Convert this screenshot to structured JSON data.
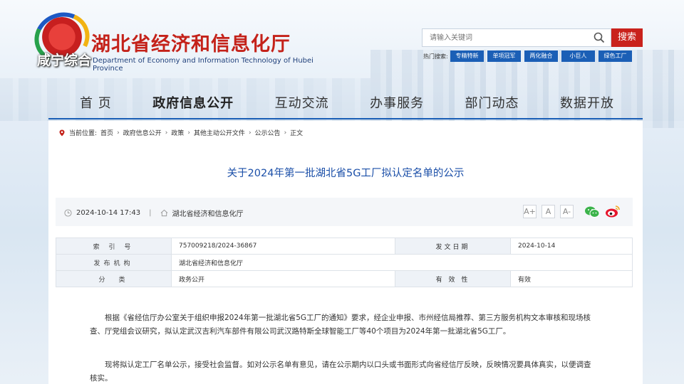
{
  "header": {
    "title_cn": "湖北省经济和信息化厅",
    "title_en": "Department of Economy and Information Technology of Hubei Province",
    "watermark": "咸宁综合",
    "search_placeholder": "请输入关键词",
    "search_button": "搜索",
    "hot_label": "热门搜索:",
    "hot_tags": [
      "专精特新",
      "单项冠军",
      "两化融合",
      "小巨人",
      "绿色工厂"
    ]
  },
  "nav": {
    "items": [
      "首 页",
      "政府信息公开",
      "互动交流",
      "办事服务",
      "部门动态",
      "数据开放"
    ],
    "active_index": 1
  },
  "breadcrumb": {
    "prefix": "当前位置:",
    "items": [
      "首页",
      "政府信息公开",
      "政策",
      "其他主动公开文件",
      "公示公告",
      "正文"
    ],
    "separator": "›"
  },
  "article": {
    "title": "关于2024年第一批湖北省5G工厂拟认定名单的公示",
    "date": "2024-10-14 17:43",
    "source": "湖北省经济和信息化厅",
    "font_buttons": [
      "A+",
      "A",
      "A-"
    ],
    "share": [
      "wechat-icon",
      "weibo-icon"
    ]
  },
  "info_table": {
    "index_label": "索 引 号",
    "index_value": "757009218/2024-36867",
    "date_label": "发文日期",
    "date_value": "2024-10-14",
    "org_label": "发布机构",
    "org_value": "湖北省经济和信息化厅",
    "category_label": "分　类",
    "category_value": "政务公开",
    "validity_label": "有 效 性",
    "validity_value": "有效"
  },
  "body": {
    "para1": "根据《省经信厅办公室关于组织申报2024年第一批湖北省5G工厂的通知》要求，经企业申报、市州经信局推荐、第三方服务机构文本审核和现场核查、厅党组会议研究，拟认定武汉吉利汽车部件有限公司武汉路特斯全球智能工厂等40个项目为2024年第一批湖北省5G工厂。",
    "para2": "现将拟认定工厂名单公示，接受社会监督。如对公示名单有意见，请在公示期内以口头或书面形式向省经信厅反映，反映情况要具体真实，以便调查核实。"
  },
  "colors": {
    "brand_red": "#c4221a",
    "brand_blue": "#1b5fb6",
    "title_blue": "#1b4fa8"
  }
}
